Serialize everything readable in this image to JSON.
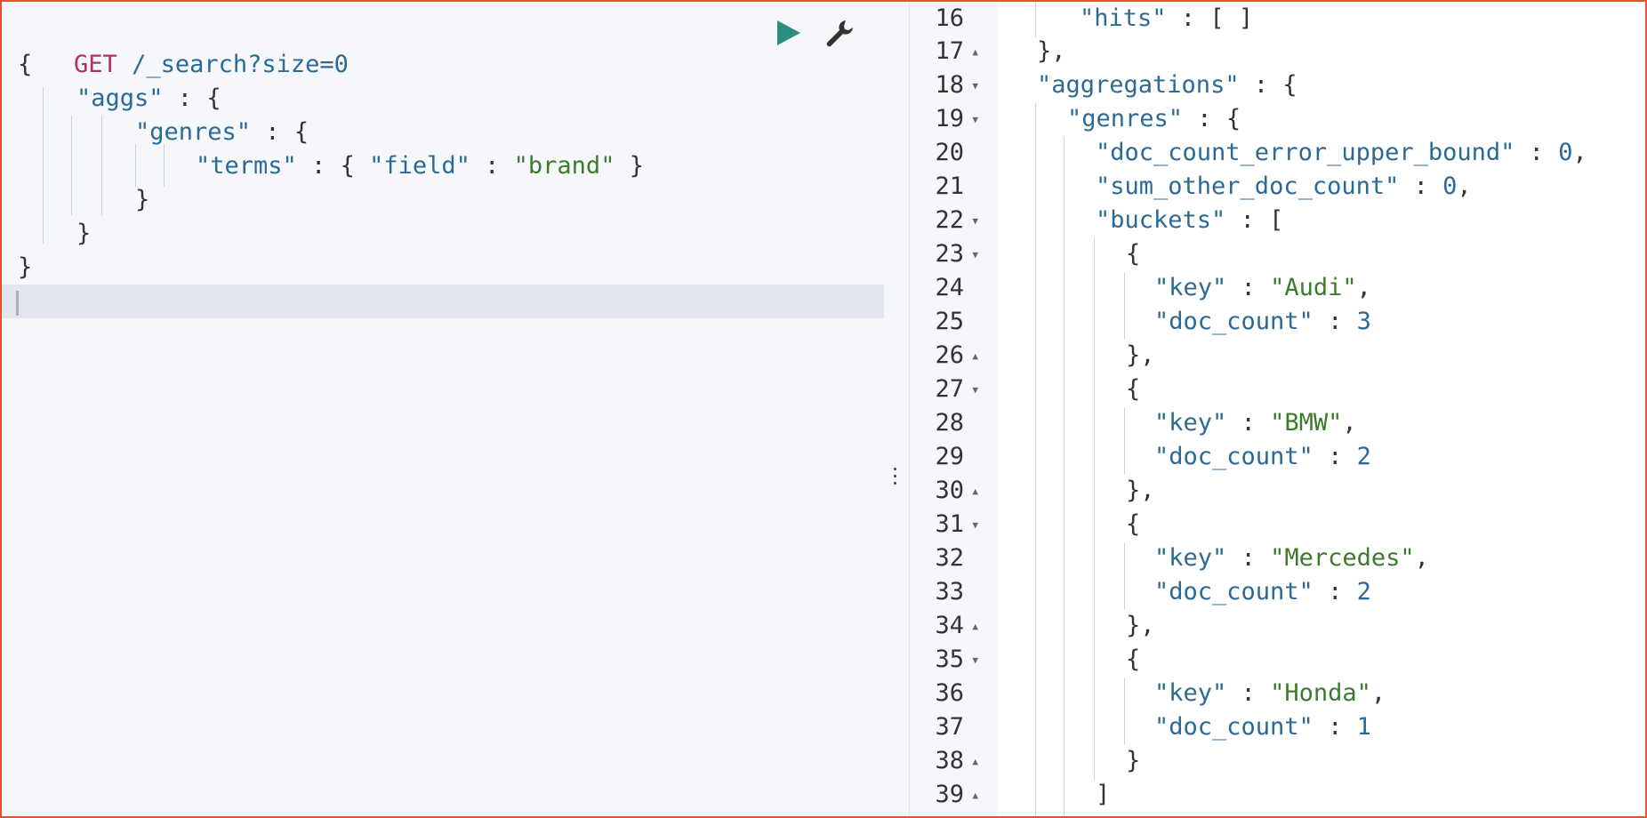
{
  "request": {
    "method": "GET",
    "path": "/_search?size=0",
    "lines": [
      "{",
      "\"aggs\" : {",
      "\"genres\" : {",
      "\"terms\" : { \"field\" : \"brand\" }",
      "}",
      "}",
      "}"
    ],
    "run_icon": "play-icon",
    "settings_icon": "wrench-icon"
  },
  "response": {
    "line_numbers": [
      "16",
      "17",
      "18",
      "19",
      "20",
      "21",
      "22",
      "23",
      "24",
      "25",
      "26",
      "27",
      "28",
      "29",
      "30",
      "31",
      "32",
      "33",
      "34",
      "35",
      "36",
      "37",
      "38",
      "39"
    ],
    "buckets": [
      {
        "key": "Audi",
        "doc_count": 3
      },
      {
        "key": "BMW",
        "doc_count": 2
      },
      {
        "key": "Mercedes",
        "doc_count": 2
      },
      {
        "key": "Honda",
        "doc_count": 1
      }
    ],
    "doc_count_error_upper_bound": 0,
    "sum_other_doc_count": 0
  },
  "colors": {
    "method": "#b5305c",
    "key": "#2b6a96",
    "string": "#3d7a2c",
    "run_button": "#2b8c7f",
    "frame": "#e4552f"
  }
}
